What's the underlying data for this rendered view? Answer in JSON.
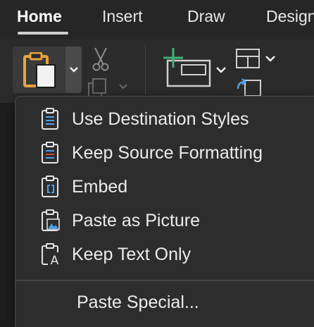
{
  "tabs": [
    {
      "label": "Home",
      "active": true
    },
    {
      "label": "Insert",
      "active": false
    },
    {
      "label": "Draw",
      "active": false
    },
    {
      "label": "Design",
      "active": false
    }
  ],
  "ribbon": {
    "icons": [
      "paste-icon",
      "chevron-down-icon",
      "scissors-icon",
      "copy-icon",
      "add-slide-icon",
      "layout-icon",
      "reset-icon"
    ]
  },
  "paste_menu": {
    "items": [
      {
        "label": "Use Destination Styles",
        "icon": "clipboard-destination-styles-icon"
      },
      {
        "label": "Keep Source Formatting",
        "icon": "clipboard-source-formatting-icon"
      },
      {
        "label": "Embed",
        "icon": "clipboard-embed-icon"
      },
      {
        "label": "Paste as Picture",
        "icon": "clipboard-picture-icon"
      },
      {
        "label": "Keep Text Only",
        "icon": "clipboard-text-only-icon"
      }
    ],
    "special_label": "Paste Special..."
  },
  "colors": {
    "accent_orange": "#e8a33a",
    "accent_blue": "#4f9fe8",
    "accent_red": "#d9473a",
    "accent_green": "#3fb37a"
  }
}
